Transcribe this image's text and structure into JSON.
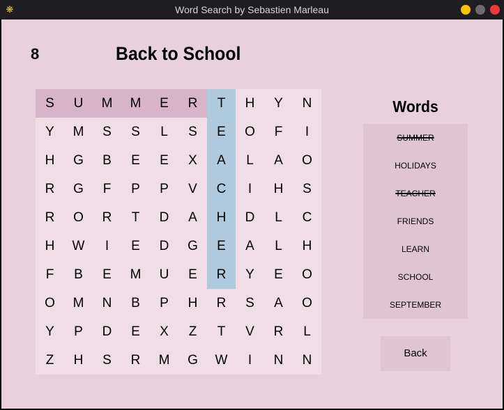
{
  "window": {
    "title": "Word Search by Sebastien Marleau"
  },
  "game": {
    "score": "8",
    "puzzle_title": "Back to School"
  },
  "grid": {
    "rows": [
      [
        "S",
        "U",
        "M",
        "M",
        "E",
        "R",
        "T",
        "H",
        "Y",
        "N"
      ],
      [
        "Y",
        "M",
        "S",
        "S",
        "L",
        "S",
        "E",
        "O",
        "F",
        "I"
      ],
      [
        "H",
        "G",
        "B",
        "E",
        "E",
        "X",
        "A",
        "L",
        "A",
        "O"
      ],
      [
        "R",
        "G",
        "F",
        "P",
        "P",
        "V",
        "C",
        "I",
        "H",
        "S"
      ],
      [
        "R",
        "O",
        "R",
        "T",
        "D",
        "A",
        "H",
        "D",
        "L",
        "C"
      ],
      [
        "H",
        "W",
        "I",
        "E",
        "D",
        "G",
        "E",
        "A",
        "L",
        "H"
      ],
      [
        "F",
        "B",
        "E",
        "M",
        "U",
        "E",
        "R",
        "Y",
        "E",
        "O"
      ],
      [
        "O",
        "M",
        "N",
        "B",
        "P",
        "H",
        "R",
        "S",
        "A",
        "O"
      ],
      [
        "Y",
        "P",
        "D",
        "E",
        "X",
        "Z",
        "T",
        "V",
        "R",
        "L"
      ],
      [
        "Z",
        "H",
        "S",
        "R",
        "M",
        "G",
        "W",
        "I",
        "N",
        "N"
      ]
    ],
    "found_highlights": [
      {
        "word": "SUMMER",
        "row": 0,
        "col": 0,
        "direction": "horizontal",
        "length": 6,
        "color": "#d8b4c8"
      },
      {
        "word": "TEACHER",
        "row": 0,
        "col": 6,
        "direction": "vertical",
        "length": 7,
        "color": "#aecadc"
      }
    ]
  },
  "words_panel": {
    "title": "Words",
    "items": [
      {
        "label": "SUMMER",
        "found": true
      },
      {
        "label": "HOLIDAYS",
        "found": false
      },
      {
        "label": "TEACHER",
        "found": true
      },
      {
        "label": "FRIENDS",
        "found": false
      },
      {
        "label": "LEARN",
        "found": false
      },
      {
        "label": "SCHOOL",
        "found": false
      },
      {
        "label": "SEPTEMBER",
        "found": false
      }
    ]
  },
  "buttons": {
    "back_label": "Back"
  },
  "colors": {
    "background": "#e8d0dc",
    "grid_background": "#f0dde6",
    "panel": "#dfc5d2",
    "found_horizontal": "#d8b4c8",
    "found_vertical": "#aecadc"
  }
}
